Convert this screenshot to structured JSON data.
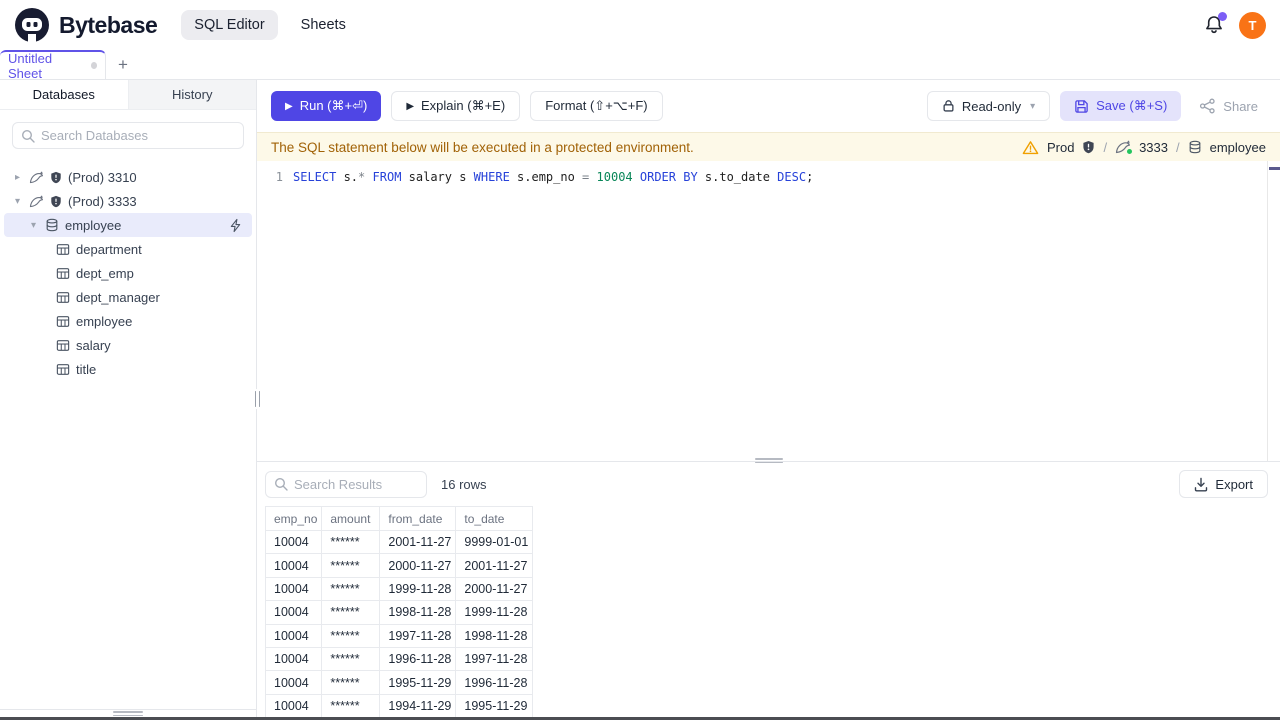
{
  "colors": {
    "accent": "#4f46e5",
    "save_bg": "#e4e3fb",
    "avatar_bg": "#f97316",
    "banner_bg": "#fdf9e8",
    "banner_text": "#a16207",
    "sql_keyword": "#2742d9",
    "sql_number": "#098658",
    "selected_row_bg": "#e9ebfb",
    "tab_accent": "#6053e8",
    "status_dot": "#22c55e"
  },
  "header": {
    "brand": "Bytebase",
    "nav": [
      {
        "label": "SQL Editor",
        "active": true
      },
      {
        "label": "Sheets",
        "active": false
      }
    ],
    "avatar_initial": "T"
  },
  "sheet_tabs": {
    "active_tab": "Untitled Sheet",
    "add_label": "+"
  },
  "sidebar": {
    "tabs": [
      {
        "label": "Databases",
        "active": true
      },
      {
        "label": "History",
        "active": false
      }
    ],
    "search_placeholder": "Search Databases",
    "tree": [
      {
        "type": "instance",
        "level": 0,
        "expanded": false,
        "label": "(Prod) 3310"
      },
      {
        "type": "instance",
        "level": 0,
        "expanded": true,
        "label": "(Prod) 3333"
      },
      {
        "type": "database",
        "level": 1,
        "expanded": true,
        "label": "employee",
        "selected": true,
        "action_icon": "bolt"
      },
      {
        "type": "table",
        "level": 2,
        "label": "department"
      },
      {
        "type": "table",
        "level": 2,
        "label": "dept_emp"
      },
      {
        "type": "table",
        "level": 2,
        "label": "dept_manager"
      },
      {
        "type": "table",
        "level": 2,
        "label": "employee"
      },
      {
        "type": "table",
        "level": 2,
        "label": "salary"
      },
      {
        "type": "table",
        "level": 2,
        "label": "title"
      }
    ]
  },
  "toolbar": {
    "run_label": "Run (⌘+⏎)",
    "explain_label": "Explain (⌘+E)",
    "format_label": "Format (⇧+⌥+F)",
    "readonly_label": "Read-only",
    "save_label": "Save (⌘+S)",
    "share_label": "Share"
  },
  "banner": {
    "message": "The SQL statement below will be executed in a protected environment.",
    "environment": "Prod",
    "instance": "3333",
    "database": "employee",
    "separator": "/"
  },
  "editor": {
    "line_number": "1",
    "sql_text": "SELECT s.* FROM salary s WHERE s.emp_no = 10004 ORDER BY s.to_date DESC;",
    "tokens": [
      {
        "text": "SELECT",
        "type": "kw"
      },
      {
        "text": " s.",
        "type": "id"
      },
      {
        "text": "*",
        "type": "op"
      },
      {
        "text": " ",
        "type": "id"
      },
      {
        "text": "FROM",
        "type": "kw"
      },
      {
        "text": " salary s ",
        "type": "id"
      },
      {
        "text": "WHERE",
        "type": "kw"
      },
      {
        "text": " s.emp_no ",
        "type": "id"
      },
      {
        "text": "=",
        "type": "op"
      },
      {
        "text": " ",
        "type": "id"
      },
      {
        "text": "10004",
        "type": "num"
      },
      {
        "text": " ",
        "type": "id"
      },
      {
        "text": "ORDER BY",
        "type": "kw"
      },
      {
        "text": " s.to_date ",
        "type": "id"
      },
      {
        "text": "DESC",
        "type": "kw"
      },
      {
        "text": ";",
        "type": "id"
      }
    ]
  },
  "results": {
    "search_placeholder": "Search Results",
    "row_count": "16 rows",
    "export_label": "Export",
    "table": {
      "columns": [
        "emp_no",
        "amount",
        "from_date",
        "to_date"
      ],
      "rows": [
        [
          "10004",
          "******",
          "2001-11-27",
          "9999-01-01"
        ],
        [
          "10004",
          "******",
          "2000-11-27",
          "2001-11-27"
        ],
        [
          "10004",
          "******",
          "1999-11-28",
          "2000-11-27"
        ],
        [
          "10004",
          "******",
          "1998-11-28",
          "1999-11-28"
        ],
        [
          "10004",
          "******",
          "1997-11-28",
          "1998-11-28"
        ],
        [
          "10004",
          "******",
          "1996-11-28",
          "1997-11-28"
        ],
        [
          "10004",
          "******",
          "1995-11-29",
          "1996-11-28"
        ],
        [
          "10004",
          "******",
          "1994-11-29",
          "1995-11-29"
        ]
      ]
    }
  }
}
